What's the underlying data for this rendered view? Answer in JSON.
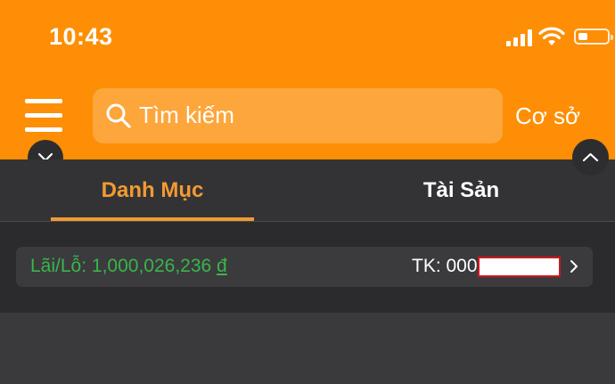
{
  "status_bar": {
    "time": "10:43",
    "icons": [
      "signal-icon",
      "wifi-icon",
      "battery-icon"
    ]
  },
  "header": {
    "background": "#fd8e05",
    "menu_icon": "menu-icon",
    "search": {
      "placeholder": "Tìm kiếm",
      "icon": "search-icon"
    },
    "base_label": "Cơ sở"
  },
  "tabs": [
    {
      "label": "Danh Mục",
      "active": true
    },
    {
      "label": "Tài Sản",
      "active": false
    }
  ],
  "account": {
    "pl_label": "Lãi/Lỗ:",
    "pl_value": "1,000,026,236",
    "currency": "đ",
    "account_prefix": "TK: 000",
    "positive_color": "#39b54a",
    "accent_color": "#f29a32"
  }
}
